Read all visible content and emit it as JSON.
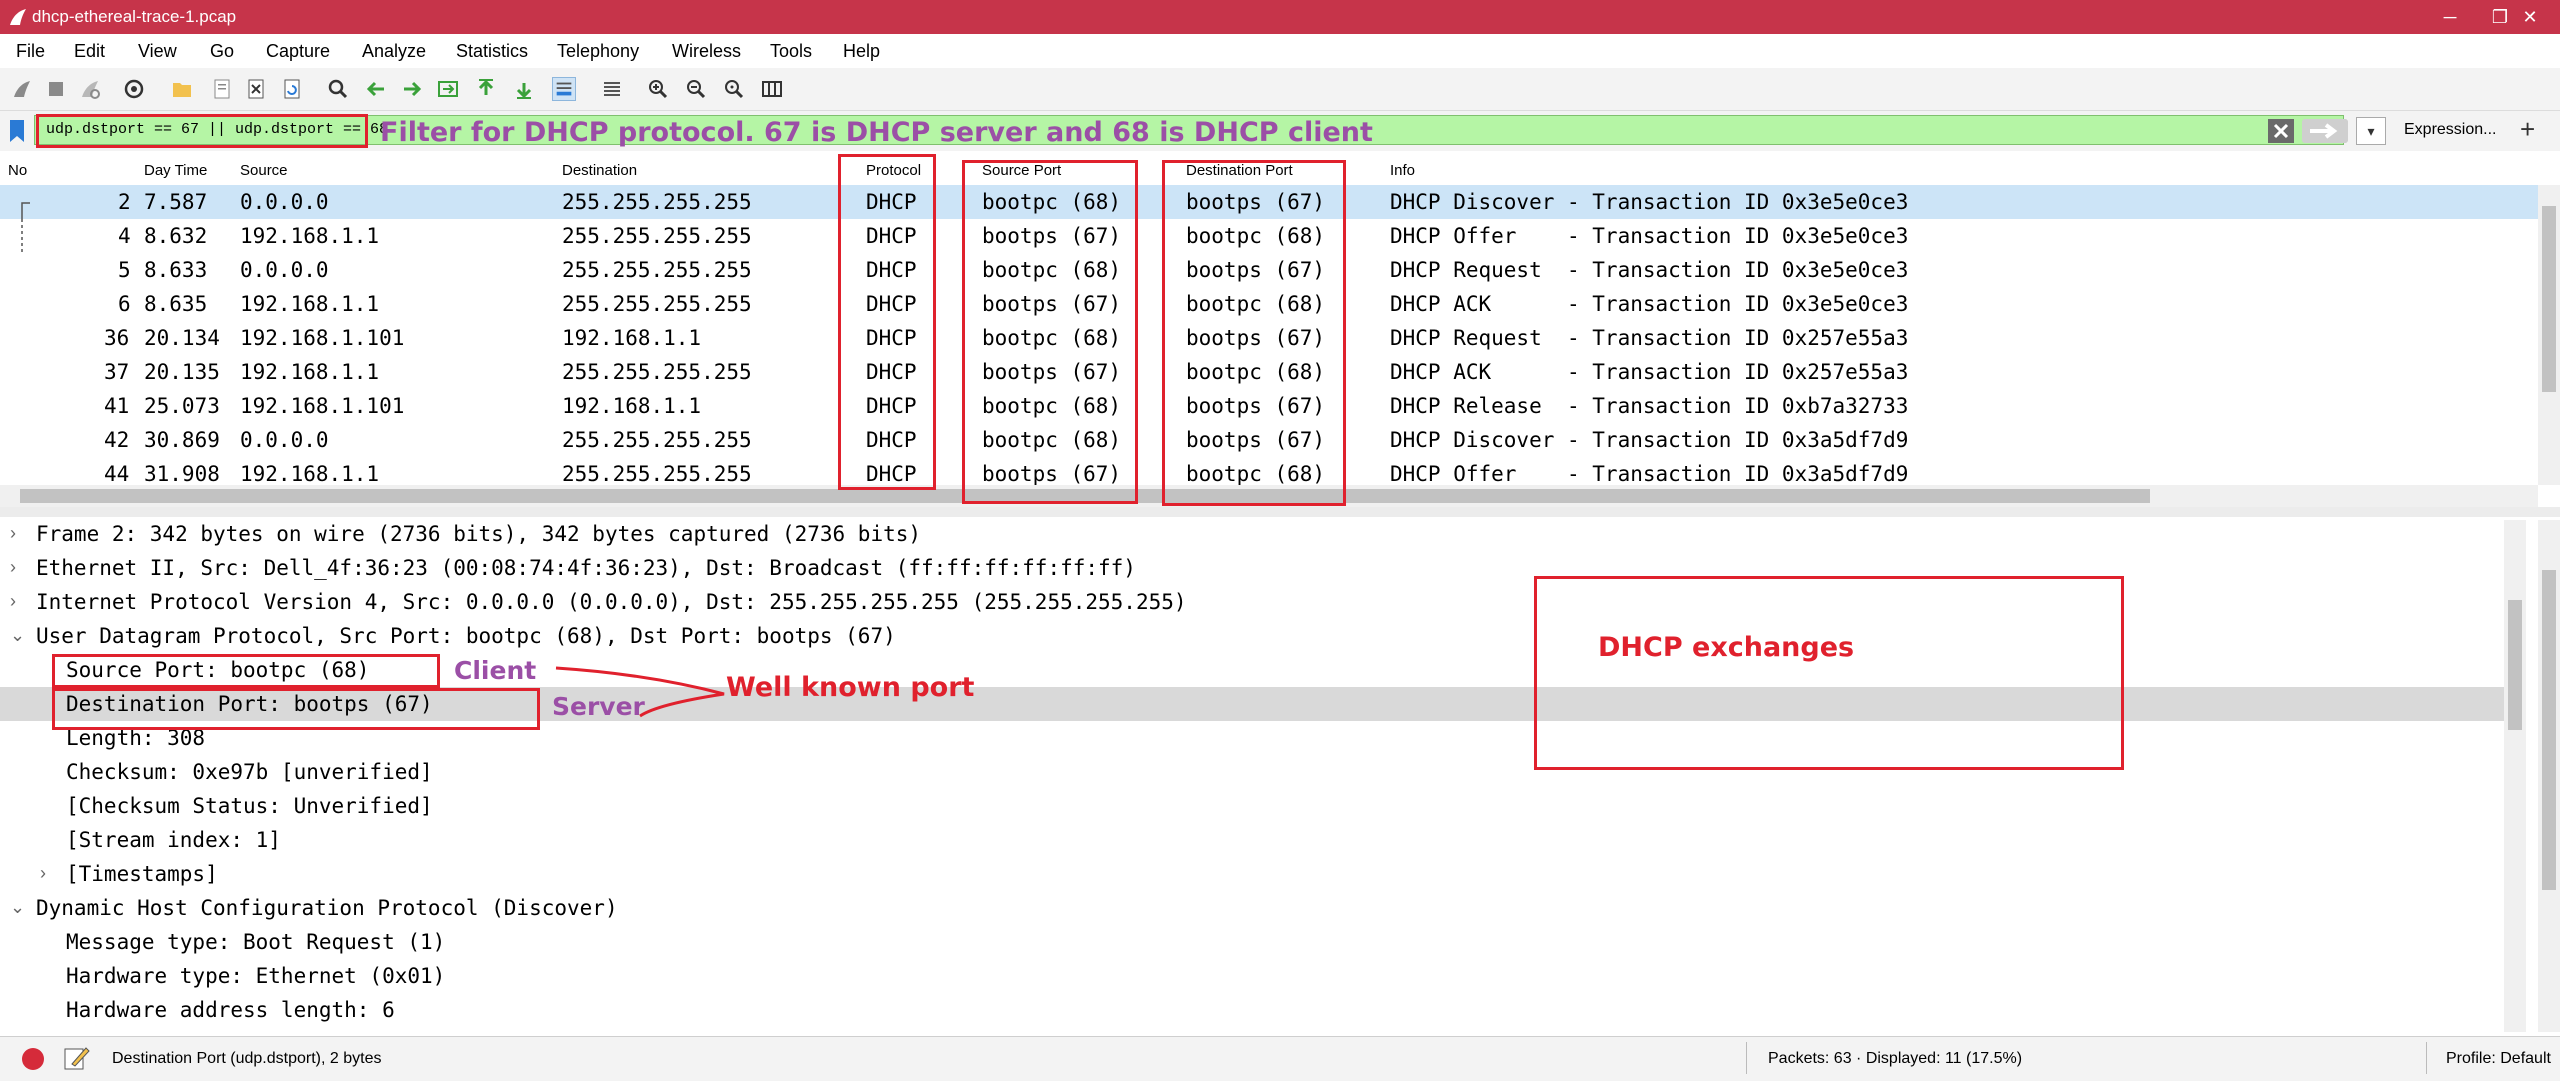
{
  "window": {
    "title": "dhcp-ethereal-trace-1.pcap",
    "minimize": "─",
    "restore": "❐",
    "close": "✕"
  },
  "menu": [
    "File",
    "Edit",
    "View",
    "Go",
    "Capture",
    "Analyze",
    "Statistics",
    "Telephony",
    "Wireless",
    "Tools",
    "Help"
  ],
  "filter": {
    "value": "udp.dstport == 67 || udp.dstport == 68",
    "dropdown": "▾",
    "expression_label": "Expression...",
    "plus": "+"
  },
  "packet_list": {
    "columns": [
      "No",
      "Day Time",
      "Source",
      "Destination",
      "Protocol",
      "Source Port",
      "Destination Port",
      "Info"
    ],
    "rows": [
      {
        "no": "2",
        "time": "7.587",
        "src": "0.0.0.0",
        "dst": "255.255.255.255",
        "proto": "DHCP",
        "sport": "bootpc (68)",
        "dport": "bootps (67)",
        "info": "DHCP Discover - Transaction ID 0x3e5e0ce3",
        "selected": true
      },
      {
        "no": "4",
        "time": "8.632",
        "src": "192.168.1.1",
        "dst": "255.255.255.255",
        "proto": "DHCP",
        "sport": "bootps (67)",
        "dport": "bootpc (68)",
        "info": "DHCP Offer    - Transaction ID 0x3e5e0ce3"
      },
      {
        "no": "5",
        "time": "8.633",
        "src": "0.0.0.0",
        "dst": "255.255.255.255",
        "proto": "DHCP",
        "sport": "bootpc (68)",
        "dport": "bootps (67)",
        "info": "DHCP Request  - Transaction ID 0x3e5e0ce3"
      },
      {
        "no": "6",
        "time": "8.635",
        "src": "192.168.1.1",
        "dst": "255.255.255.255",
        "proto": "DHCP",
        "sport": "bootps (67)",
        "dport": "bootpc (68)",
        "info": "DHCP ACK      - Transaction ID 0x3e5e0ce3"
      },
      {
        "no": "36",
        "time": "20.134",
        "src": "192.168.1.101",
        "dst": "192.168.1.1",
        "proto": "DHCP",
        "sport": "bootpc (68)",
        "dport": "bootps (67)",
        "info": "DHCP Request  - Transaction ID 0x257e55a3"
      },
      {
        "no": "37",
        "time": "20.135",
        "src": "192.168.1.1",
        "dst": "255.255.255.255",
        "proto": "DHCP",
        "sport": "bootps (67)",
        "dport": "bootpc (68)",
        "info": "DHCP ACK      - Transaction ID 0x257e55a3"
      },
      {
        "no": "41",
        "time": "25.073",
        "src": "192.168.1.101",
        "dst": "192.168.1.1",
        "proto": "DHCP",
        "sport": "bootpc (68)",
        "dport": "bootps (67)",
        "info": "DHCP Release  - Transaction ID 0xb7a32733"
      },
      {
        "no": "42",
        "time": "30.869",
        "src": "0.0.0.0",
        "dst": "255.255.255.255",
        "proto": "DHCP",
        "sport": "bootpc (68)",
        "dport": "bootps (67)",
        "info": "DHCP Discover - Transaction ID 0x3a5df7d9"
      },
      {
        "no": "44",
        "time": "31.908",
        "src": "192.168.1.1",
        "dst": "255.255.255.255",
        "proto": "DHCP",
        "sport": "bootps (67)",
        "dport": "bootpc (68)",
        "info": "DHCP Offer    - Transaction ID 0x3a5df7d9"
      }
    ]
  },
  "details": [
    {
      "text": "Frame 2: 342 bytes on wire (2736 bits), 342 bytes captured (2736 bits)",
      "indent": 0,
      "expander": "›"
    },
    {
      "text": "Ethernet II, Src: Dell_4f:36:23 (00:08:74:4f:36:23), Dst: Broadcast (ff:ff:ff:ff:ff:ff)",
      "indent": 0,
      "expander": "›"
    },
    {
      "text": "Internet Protocol Version 4, Src: 0.0.0.0 (0.0.0.0), Dst: 255.255.255.255 (255.255.255.255)",
      "indent": 0,
      "expander": "›"
    },
    {
      "text": "User Datagram Protocol, Src Port: bootpc (68), Dst Port: bootps (67)",
      "indent": 0,
      "expander": "⌄"
    },
    {
      "text": "Source Port: bootpc (68)",
      "indent": 1,
      "expander": ""
    },
    {
      "text": "Destination Port: bootps (67)",
      "indent": 1,
      "expander": "",
      "highlight": true
    },
    {
      "text": "Length: 308",
      "indent": 1,
      "expander": ""
    },
    {
      "text": "Checksum: 0xe97b [unverified]",
      "indent": 1,
      "expander": ""
    },
    {
      "text": "[Checksum Status: Unverified]",
      "indent": 1,
      "expander": ""
    },
    {
      "text": "[Stream index: 1]",
      "indent": 1,
      "expander": ""
    },
    {
      "text": "[Timestamps]",
      "indent": 1,
      "expander": "›"
    },
    {
      "text": "Dynamic Host Configuration Protocol (Discover)",
      "indent": 0,
      "expander": "⌄"
    },
    {
      "text": "Message type: Boot Request (1)",
      "indent": 1,
      "expander": ""
    },
    {
      "text": "Hardware type: Ethernet (0x01)",
      "indent": 1,
      "expander": ""
    },
    {
      "text": "Hardware address length: 6",
      "indent": 1,
      "expander": ""
    }
  ],
  "status": {
    "field": "Destination Port (udp.dstport), 2 bytes",
    "packets": "Packets: 63 · Displayed: 11 (17.5%)",
    "profile": "Profile: Default"
  },
  "annotations": {
    "filter_note": "Filter for DHCP protocol. 67 is DHCP server and 68 is DHCP client",
    "client": "Client",
    "server": "Server",
    "well_known": "Well known port",
    "exchanges": "DHCP exchanges"
  },
  "colors": {
    "titlebar": "#c6344a",
    "filter_bg": "#b5f5a5",
    "selected_row": "#cce4f7",
    "annotation_red": "#e0212d",
    "annotation_purple": "#9b4fa6"
  }
}
